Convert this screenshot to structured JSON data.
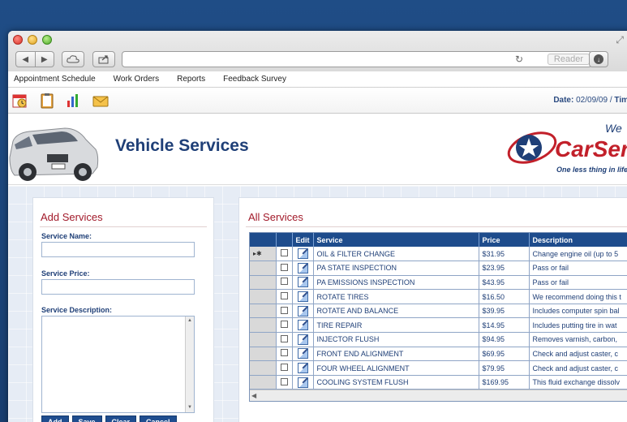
{
  "browser": {
    "reader_label": "Reader",
    "url": ""
  },
  "menu": [
    "Appointment Schedule",
    "Work Orders",
    "Reports",
    "Feedback Survey"
  ],
  "toolbar_icons": [
    "calendar-clock-icon",
    "clipboard-icon",
    "bar-chart-icon",
    "envelope-icon"
  ],
  "date_info": {
    "label": "Date:",
    "value": "02/09/09",
    "sep": "/",
    "time_label": "Tim"
  },
  "banner": {
    "title": "Vehicle Services",
    "brand_name": "CarSer",
    "brand_greeting": "We",
    "brand_tagline": "One less thing in life"
  },
  "add_services": {
    "title": "Add Services",
    "name_label": "Service Name:",
    "price_label": "Service Price:",
    "desc_label": "Service Description:",
    "buttons": {
      "add": "Add",
      "save": "Save",
      "clear": "Clear",
      "cancel": "Cancel"
    }
  },
  "all_services": {
    "title": "All Services",
    "columns": {
      "edit": "Edit",
      "service": "Service",
      "price": "Price",
      "description": "Description"
    },
    "rows": [
      {
        "service": "OIL & FILTER CHANGE",
        "price": "$31.95",
        "description": "Change engine oil (up to 5"
      },
      {
        "service": "PA STATE INSPECTION",
        "price": "$23.95",
        "description": "Pass or fail"
      },
      {
        "service": "PA EMISSIONS INSPECTION",
        "price": "$43.95",
        "description": "Pass or fail"
      },
      {
        "service": "ROTATE TIRES",
        "price": "$16.50",
        "description": "We recommend doing this t"
      },
      {
        "service": "ROTATE AND BALANCE",
        "price": "$39.95",
        "description": "Includes computer spin bal"
      },
      {
        "service": "TIRE REPAIR",
        "price": "$14.95",
        "description": "Includes putting tire in wat"
      },
      {
        "service": "INJECTOR FLUSH",
        "price": "$94.95",
        "description": "Removes varnish, carbon,"
      },
      {
        "service": "FRONT END ALIGNMENT",
        "price": "$69.95",
        "description": "Check and adjust caster, c"
      },
      {
        "service": "FOUR WHEEL ALIGNMENT",
        "price": "$79.95",
        "description": "Check and adjust caster, c"
      },
      {
        "service": "COOLING SYSTEM FLUSH",
        "price": "$169.95",
        "description": "This fluid exchange dissolv"
      }
    ],
    "current_row_marker": "▸✱"
  }
}
